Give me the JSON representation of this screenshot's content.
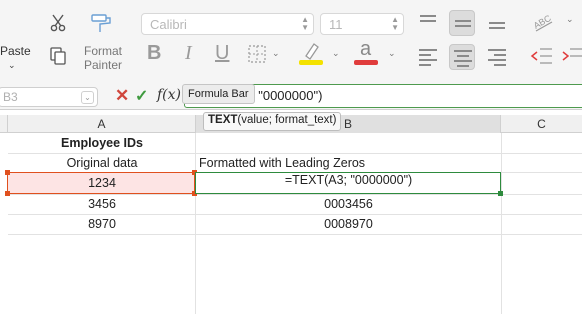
{
  "ribbon": {
    "clipboard": {
      "paste_label": "Paste",
      "format_painter_line1": "Format",
      "format_painter_line2": "Painter"
    },
    "font": {
      "name": "Calibri",
      "size": "11",
      "bold": "B",
      "italic": "I",
      "underline": "U",
      "font_color_glyph": "a"
    },
    "colors": {
      "highlight": "#f4e200",
      "font_color": "#e03c3c",
      "accent_green": "#2e8b3e",
      "ref_orange": "#e0501e"
    },
    "icons": [
      "scissors-icon",
      "copy-icon",
      "format-painter-icon",
      "borders-icon",
      "highlight-icon",
      "font-color-icon",
      "align-icon",
      "text-orientation-icon",
      "indent-icon"
    ]
  },
  "formula_bar": {
    "name_box": "B3",
    "formula_visible": "; \"0000000\")",
    "tooltip": "Formula Bar",
    "fx_label": "f(x)"
  },
  "grid": {
    "columns": [
      "A",
      "B",
      "C"
    ],
    "function_hint": {
      "name": "TEXT",
      "args": "(value; format_text)"
    },
    "rows": [
      {
        "a": "Employee IDs",
        "b": ""
      },
      {
        "a": "Original data",
        "b": "Formatted with Leading Zeros"
      },
      {
        "a": "1234",
        "b": "=TEXT(A3; \"0000000\")"
      },
      {
        "a": "3456",
        "b": "0003456"
      },
      {
        "a": "8970",
        "b": "0008970"
      }
    ]
  }
}
